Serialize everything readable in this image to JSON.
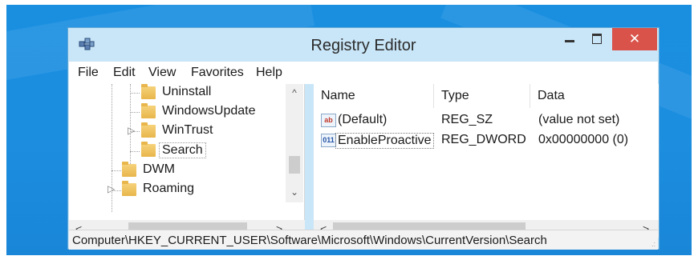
{
  "window": {
    "title": "Registry Editor",
    "icons": {
      "app": "registry-editor-icon",
      "minimize": "minimize-icon",
      "maximize": "maximize-icon",
      "close": "close-icon"
    },
    "close_glyph": "✕"
  },
  "menu": [
    "File",
    "Edit",
    "View",
    "Favorites",
    "Help"
  ],
  "tree": {
    "items": [
      {
        "label": "Uninstall",
        "icon": "folder-icon",
        "expander": "",
        "selected": false
      },
      {
        "label": "WindowsUpdate",
        "icon": "folder-icon",
        "expander": "",
        "selected": false
      },
      {
        "label": "WinTrust",
        "icon": "folder-icon",
        "expander": "▷",
        "selected": false
      },
      {
        "label": "Search",
        "icon": "folder-icon",
        "expander": "",
        "selected": true
      },
      {
        "label": "DWM",
        "icon": "folder-icon",
        "expander": "",
        "selected": false
      },
      {
        "label": "Roaming",
        "icon": "folder-icon",
        "expander": "▷",
        "selected": false
      }
    ]
  },
  "values_table": {
    "columns": [
      "Name",
      "Type",
      "Data"
    ],
    "rows": [
      {
        "name": "(Default)",
        "type": "REG_SZ",
        "data": "(value not set)",
        "icon": "string-value-icon",
        "icon_text": "ab"
      },
      {
        "name": "EnableProactive",
        "type": "REG_DWORD",
        "data": "0x00000000 (0)",
        "icon": "binary-value-icon",
        "icon_text": "011"
      }
    ]
  },
  "scrollbars": {
    "up": "^",
    "down": "⌄",
    "left": "<",
    "right": ">"
  },
  "status": {
    "path": "Computer\\HKEY_CURRENT_USER\\Software\\Microsoft\\Windows\\CurrentVersion\\Search",
    "grip": ".:"
  },
  "colors": {
    "desktop": "#1a8fe0",
    "titlebar": "#c9e6f8",
    "close_button": "#d9534a"
  }
}
